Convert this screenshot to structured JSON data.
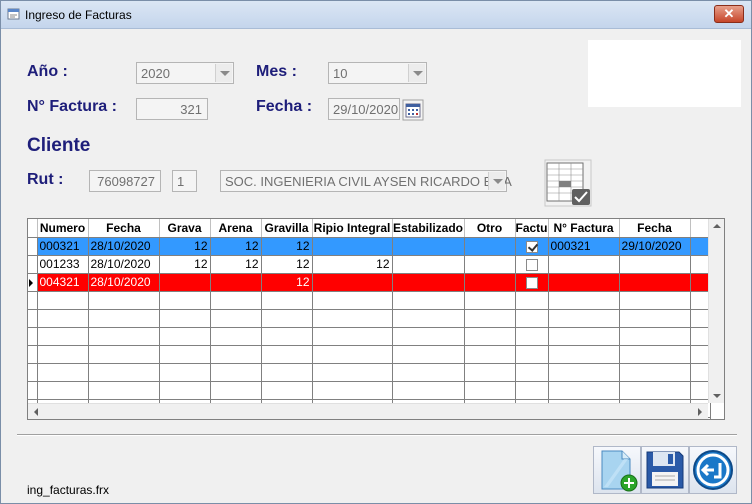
{
  "window": {
    "title": "Ingreso de Facturas",
    "close_symbol": "✕"
  },
  "form": {
    "ano_label": "Año :",
    "ano_value": "2020",
    "mes_label": "Mes :",
    "mes_value": "10",
    "factura_label": "N° Factura :",
    "factura_value": "321",
    "fecha_label": "Fecha :",
    "fecha_value": "29/10/2020",
    "cliente_label": "Cliente",
    "rut_label": "Rut :",
    "rut_value": "76098727",
    "rut_dv": "1",
    "cliente_value": "SOC. INGENIERIA CIVIL AYSEN RICARDO ELIA"
  },
  "grid": {
    "columns": [
      "Numero",
      "Fecha",
      "Grava",
      "Arena",
      "Gravilla",
      "Ripio Integral",
      "Estabilizado",
      "Otro",
      "Factu",
      "N° Factura",
      "Fecha"
    ],
    "rows": [
      {
        "numero": "000321",
        "fecha": "28/10/2020",
        "grava": "12",
        "arena": "12",
        "gravilla": "12",
        "ripio": "",
        "estab": "",
        "otro": "",
        "factu": true,
        "nfactura": "000321",
        "fecha2": "29/10/2020",
        "style": "sel"
      },
      {
        "numero": "001233",
        "fecha": "28/10/2020",
        "grava": "12",
        "arena": "12",
        "gravilla": "12",
        "ripio": "12",
        "estab": "",
        "otro": "",
        "factu": false,
        "nfactura": "",
        "fecha2": "",
        "style": "normal"
      },
      {
        "numero": "004321",
        "fecha": "28/10/2020",
        "grava": "",
        "arena": "",
        "gravilla": "12",
        "ripio": "",
        "estab": "",
        "otro": "",
        "factu": false,
        "nfactura": "",
        "fecha2": "",
        "style": "red"
      }
    ],
    "empty_rows": 8
  },
  "footer": {
    "filename": "ing_facturas.frx"
  },
  "colors": {
    "selected_row": "#3399ff",
    "error_row": "#ff0000",
    "label": "#1e1e7a"
  },
  "icons": {
    "title": "form-icon",
    "calendar": "calendar-icon",
    "new": "new-document-icon",
    "save": "save-icon",
    "exit": "exit-icon"
  }
}
